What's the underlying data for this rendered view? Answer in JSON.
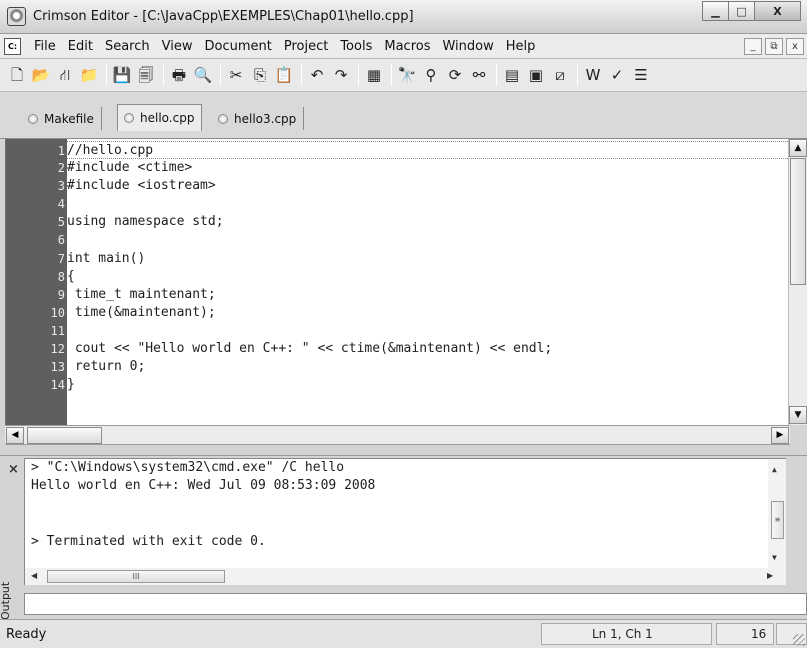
{
  "window": {
    "title": "Crimson Editor - [C:\\JavaCpp\\EXEMPLES\\Chap01\\hello.cpp]",
    "controls": {
      "minimize": "▁",
      "maximize": "□",
      "close": "X"
    }
  },
  "menu": {
    "doc_icon_text": "C:",
    "items": [
      "File",
      "Edit",
      "Search",
      "View",
      "Document",
      "Project",
      "Tools",
      "Macros",
      "Window",
      "Help"
    ],
    "mdi": {
      "minimize": "_",
      "restore": "⧉",
      "close": "x"
    }
  },
  "toolbar": {
    "buttons": [
      {
        "name": "new-file-icon",
        "glyph": "🗋"
      },
      {
        "name": "open-file-icon",
        "glyph": "📂"
      },
      {
        "name": "open-project-icon",
        "glyph": "⛙"
      },
      {
        "name": "open-remote-icon",
        "glyph": "📁"
      },
      {
        "sep": true
      },
      {
        "name": "save-icon",
        "glyph": "💾"
      },
      {
        "name": "save-all-icon",
        "glyph": "🗐"
      },
      {
        "sep": true
      },
      {
        "name": "print-icon",
        "glyph": "🖶"
      },
      {
        "name": "print-preview-icon",
        "glyph": "🔍"
      },
      {
        "sep": true
      },
      {
        "name": "cut-icon",
        "glyph": "✂"
      },
      {
        "name": "copy-icon",
        "glyph": "⎘"
      },
      {
        "name": "paste-icon",
        "glyph": "📋"
      },
      {
        "sep": true
      },
      {
        "name": "undo-icon",
        "glyph": "↶"
      },
      {
        "name": "redo-icon",
        "glyph": "↷"
      },
      {
        "sep": true
      },
      {
        "name": "column-mode-icon",
        "glyph": "▦"
      },
      {
        "sep": true
      },
      {
        "name": "find-icon",
        "glyph": "🔭"
      },
      {
        "name": "find-next-icon",
        "glyph": "⚲"
      },
      {
        "name": "replace-icon",
        "glyph": "⟳"
      },
      {
        "name": "find-in-files-icon",
        "glyph": "⚯"
      },
      {
        "sep": true
      },
      {
        "name": "toggle-directory-icon",
        "glyph": "▤"
      },
      {
        "name": "toggle-output-icon",
        "glyph": "▣"
      },
      {
        "name": "toggle-project-icon",
        "glyph": "⧄"
      },
      {
        "sep": true
      },
      {
        "name": "word-wrap-icon",
        "glyph": "W"
      },
      {
        "name": "spell-check-icon",
        "glyph": "✓"
      },
      {
        "name": "line-numbers-icon",
        "glyph": "☰"
      }
    ]
  },
  "tabs": [
    {
      "label": "Makefile",
      "active": false
    },
    {
      "label": "hello.cpp",
      "active": true
    },
    {
      "label": "hello3.cpp",
      "active": false
    }
  ],
  "editor": {
    "lines": [
      {
        "num": "1",
        "text": "//hello.cpp"
      },
      {
        "num": "2",
        "text": "#include <ctime>"
      },
      {
        "num": "3",
        "text": "#include <iostream>"
      },
      {
        "num": "4",
        "text": ""
      },
      {
        "num": "5",
        "text": "using namespace std;"
      },
      {
        "num": "6",
        "text": ""
      },
      {
        "num": "7",
        "text": "int main()"
      },
      {
        "num": "8",
        "text": "{"
      },
      {
        "num": "9",
        "text": " time_t maintenant;"
      },
      {
        "num": "10",
        "text": " time(&maintenant);"
      },
      {
        "num": "11",
        "text": ""
      },
      {
        "num": "12",
        "text": " cout << \"Hello world en C++: \" << ctime(&maintenant) << endl;"
      },
      {
        "num": "13",
        "text": " return 0;"
      },
      {
        "num": "14",
        "text": "}"
      }
    ],
    "scroll_up": "▲",
    "scroll_down": "▼",
    "scroll_left": "◀",
    "scroll_right": "▶"
  },
  "output": {
    "close_glyph": "×",
    "label": "Output",
    "lines": [
      "> \"C:\\Windows\\system32\\cmd.exe\" /C hello",
      "Hello world en C++: Wed Jul 09 08:53:09 2008",
      "",
      "",
      "> Terminated with exit code 0."
    ],
    "scroll_up": "▲",
    "scroll_down": "▼",
    "scroll_left": "◀",
    "scroll_right": "▶",
    "vthumb_grip": "≡",
    "hthumb_grip": "III"
  },
  "status": {
    "ready": "Ready",
    "position": "Ln 1, Ch 1",
    "value": "16"
  }
}
